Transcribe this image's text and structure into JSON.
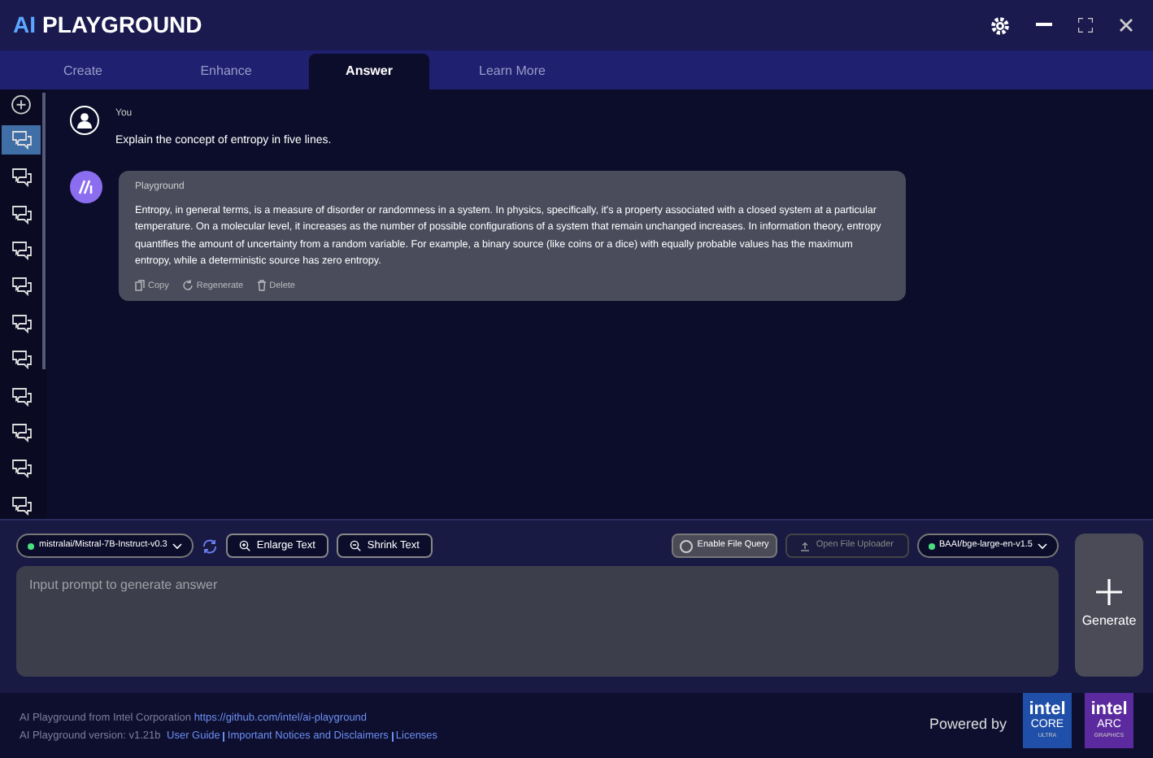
{
  "window": {
    "title_prefix": "AI",
    "title": "PLAYGROUND"
  },
  "tabs": [
    {
      "label": "Create",
      "selected": false
    },
    {
      "label": "Enhance",
      "selected": false
    },
    {
      "label": "Answer",
      "selected": true
    },
    {
      "label": "Learn More",
      "selected": false
    }
  ],
  "sidebar": {
    "items": [
      {
        "selected": true
      },
      {
        "selected": false
      },
      {
        "selected": false
      },
      {
        "selected": false
      },
      {
        "selected": false
      },
      {
        "selected": false
      },
      {
        "selected": false
      },
      {
        "selected": false
      },
      {
        "selected": false
      },
      {
        "selected": false
      },
      {
        "selected": false
      }
    ]
  },
  "messages": [
    {
      "kind": "user",
      "author": "You",
      "text": "Explain the concept of entropy in five lines."
    },
    {
      "kind": "assistant",
      "author": "Playground",
      "text": "Entropy, in general terms, is a measure of disorder or randomness in a system. In physics, specifically, it's a property associated with a closed system at a particular temperature. On a molecular level, it increases as the number of possible configurations of a system that remain unchanged increases. In information theory, entropy quantifies the amount of uncertainty from a random variable. For example, a binary source (like coins or a dice) with equally probable values has the maximum entropy, while a deterministic source has zero entropy.",
      "actions": [
        "Copy",
        "Regenerate",
        "Delete"
      ]
    }
  ],
  "toolbar": {
    "model": "mistralai/Mistral-7B-Instruct-v0.3",
    "enlarge": "Enlarge Text",
    "shrink": "Shrink Text",
    "file_query": {
      "label": "Enable File Query",
      "checked": false
    },
    "uploader": {
      "label": "Open File Uploader",
      "disabled": true
    },
    "embedding_model": "BAAI/bge-large-en-v1.5"
  },
  "prompt": {
    "placeholder": "Input prompt to generate answer"
  },
  "generate_button": "Generate",
  "footer": {
    "line1": "AI Playground from Intel Corporation ",
    "repo_link": "https://github.com/intel/ai-playground",
    "line2": "AI Playground version: v1.21b ",
    "links": [
      "User Guide",
      "Important Notices and Disclaimers",
      "Licenses"
    ],
    "powered_by": "Powered by",
    "badges": [
      {
        "brand": "intel",
        "product": "CORE",
        "tier": "ULTRA",
        "color": "#1f4fa8"
      },
      {
        "brand": "intel",
        "product": "ARC",
        "tier": "GRAPHICS",
        "color": "#5b2a9e"
      }
    ]
  }
}
